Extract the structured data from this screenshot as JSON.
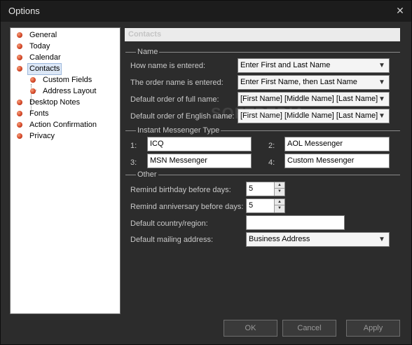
{
  "window": {
    "title": "Options",
    "close_label": "✕"
  },
  "tree": {
    "items": [
      {
        "label": "General",
        "level": 0,
        "selected": false
      },
      {
        "label": "Today",
        "level": 0,
        "selected": false
      },
      {
        "label": "Calendar",
        "level": 0,
        "selected": false
      },
      {
        "label": "Contacts",
        "level": 0,
        "selected": true
      },
      {
        "label": "Custom Fields",
        "level": 1,
        "selected": false
      },
      {
        "label": "Address Layout",
        "level": 1,
        "selected": false
      },
      {
        "label": "Desktop Notes",
        "level": 0,
        "selected": false
      },
      {
        "label": "Fonts",
        "level": 0,
        "selected": false
      },
      {
        "label": "Action Confirmation",
        "level": 0,
        "selected": false
      },
      {
        "label": "Privacy",
        "level": 0,
        "selected": false
      }
    ]
  },
  "panel": {
    "header": "Contacts",
    "name_group": {
      "label": "Name",
      "how_entered_label": "How name is entered:",
      "how_entered_value": "Enter First and Last Name",
      "order_entered_label": "The order name is entered:",
      "order_entered_value": "Enter First Name, then Last Name",
      "full_order_label": "Default order of full name:",
      "full_order_value": "[First Name] [Middle Name] [Last Name]",
      "english_order_label": "Default order of English name:",
      "english_order_value": "[First Name] [Middle Name] [Last Name]"
    },
    "im_group": {
      "label": "Instant Messenger Type",
      "items": [
        {
          "num": "1:",
          "value": "ICQ"
        },
        {
          "num": "2:",
          "value": "AOL Messenger"
        },
        {
          "num": "3:",
          "value": "MSN Messenger"
        },
        {
          "num": "4:",
          "value": "Custom Messenger"
        }
      ]
    },
    "other_group": {
      "label": "Other",
      "birthday_label": "Remind birthday before days:",
      "birthday_value": "5",
      "anniversary_label": "Remind anniversary before days:",
      "anniversary_value": "5",
      "country_label": "Default country/region:",
      "country_value": "",
      "mailing_label": "Default mailing address:",
      "mailing_value": "Business Address"
    }
  },
  "buttons": {
    "ok": "OK",
    "cancel": "Cancel",
    "apply": "Apply"
  },
  "watermark": "SOFTPEDIA"
}
